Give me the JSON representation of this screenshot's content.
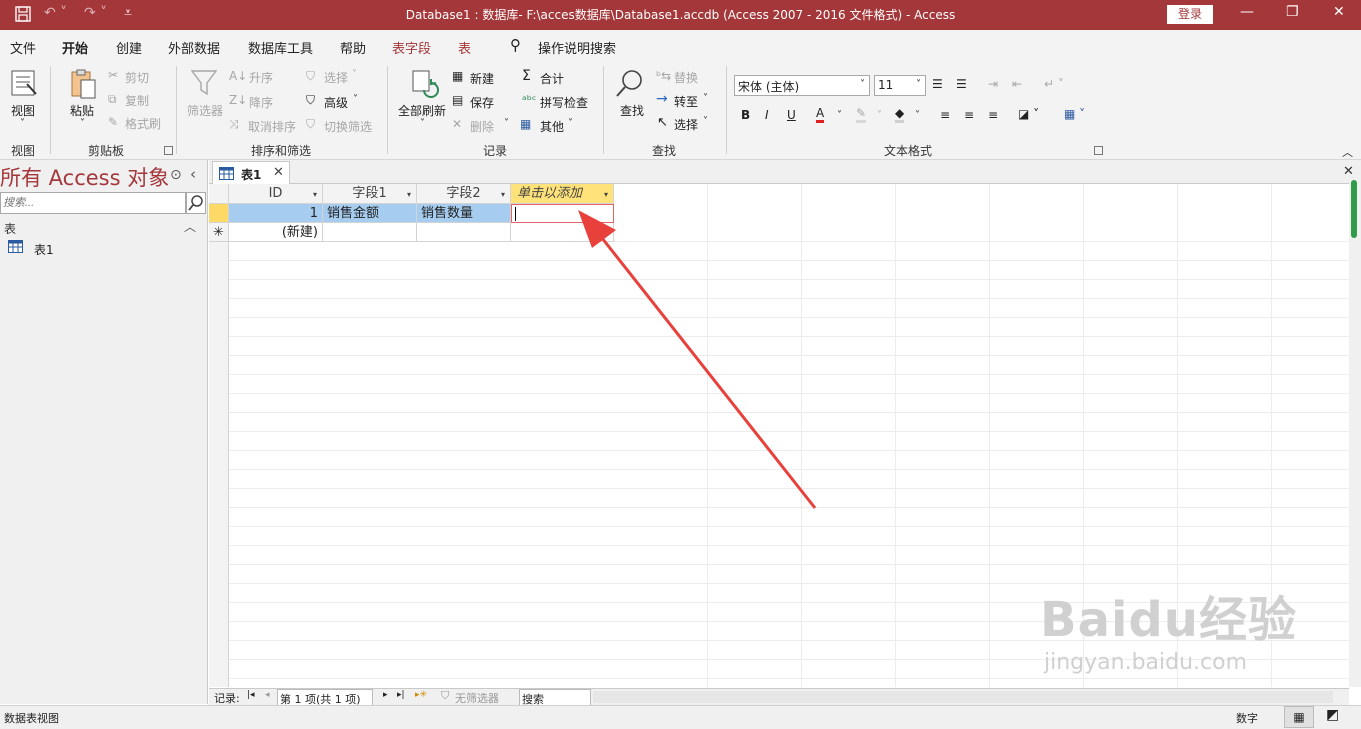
{
  "titlebar": {
    "title": "Database1 : 数据库- F:\\acces数据库\\Database1.accdb (Access 2007 - 2016 文件格式)  -  Access",
    "login": "登录"
  },
  "menu": {
    "file": "文件",
    "home": "开始",
    "create": "创建",
    "external": "外部数据",
    "dbtools": "数据库工具",
    "help": "帮助",
    "table_fields": "表字段",
    "table": "表",
    "tell_me": "操作说明搜索"
  },
  "ribbon": {
    "view": {
      "btn": "视图",
      "label": "视图"
    },
    "clipboard": {
      "paste": "粘贴",
      "cut": "剪切",
      "copy": "复制",
      "format_painter": "格式刷",
      "label": "剪贴板"
    },
    "sort": {
      "filter": "筛选器",
      "asc": "升序",
      "desc": "降序",
      "clear": "取消排序",
      "select": "选择",
      "advanced": "高级",
      "toggle": "切换筛选",
      "label": "排序和筛选"
    },
    "records": {
      "refresh": "全部刷新",
      "new": "新建",
      "save": "保存",
      "delete": "删除",
      "totals": "合计",
      "spell": "拼写检查",
      "more": "其他",
      "label": "记录"
    },
    "find": {
      "find": "查找",
      "replace": "替换",
      "goto": "转至",
      "select": "选择",
      "label": "查找"
    },
    "text": {
      "font": "宋体 (主体)",
      "size": "11",
      "label": "文本格式"
    }
  },
  "nav": {
    "title": "所有 Access 对象",
    "search_placeholder": "搜索...",
    "section": "表",
    "item": "表1"
  },
  "doc": {
    "tab": "表1",
    "headers": [
      "ID",
      "字段1",
      "字段2",
      "单击以添加"
    ],
    "row1": {
      "id": "1",
      "f1": "销售金额",
      "f2": "销售数量"
    },
    "new_row": "(新建)"
  },
  "recnav": {
    "label": "记录:",
    "position": "第 1 项(共 1 项)",
    "filter": "无筛选器",
    "search": "搜索"
  },
  "status": {
    "left": "数据表视图",
    "num": "数字"
  },
  "watermark": {
    "brand": "Baidu经验",
    "url": "jingyan.baidu.com"
  },
  "colors": {
    "accent": "#a4373a",
    "selection": "#a6cdf0",
    "add_header": "#ffe27a",
    "arrow": "#e8413c"
  }
}
